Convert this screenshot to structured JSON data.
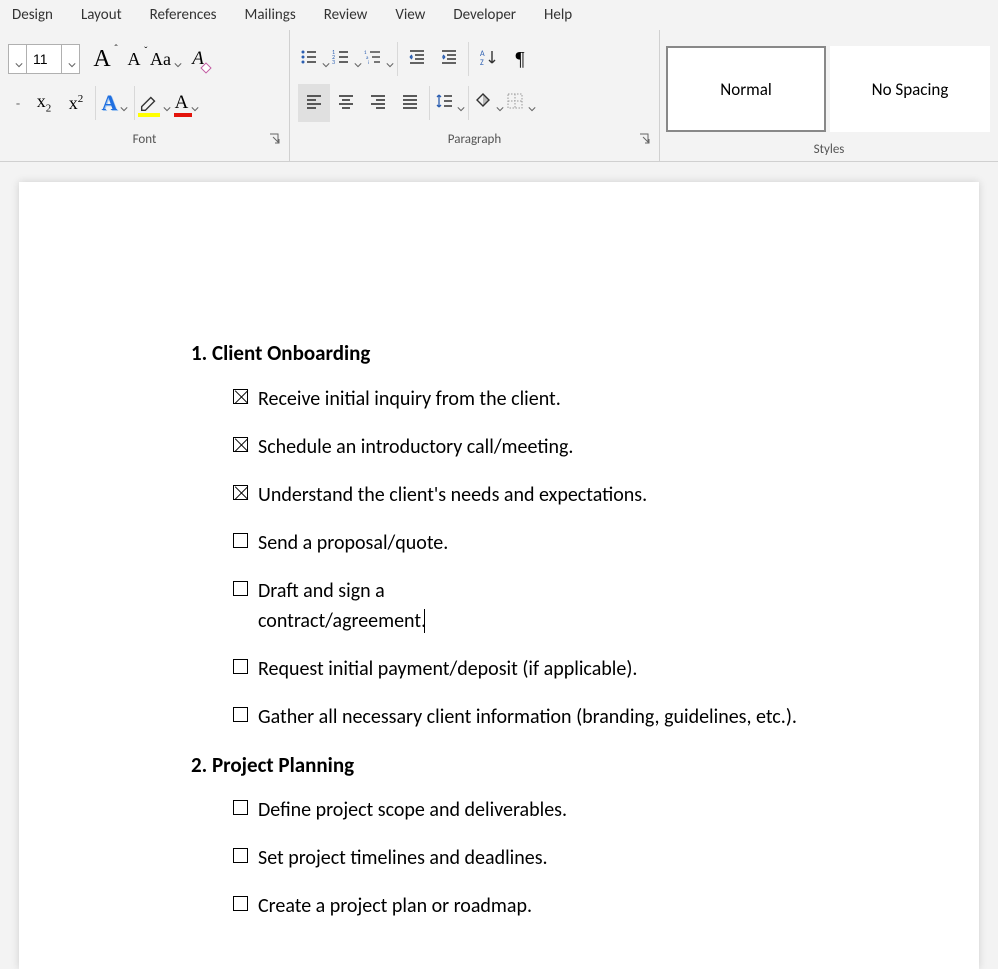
{
  "tabs": [
    "Design",
    "Layout",
    "References",
    "Mailings",
    "Review",
    "View",
    "Developer",
    "Help"
  ],
  "font": {
    "size": "11",
    "groupLabel": "Font"
  },
  "paragraph": {
    "groupLabel": "Paragraph"
  },
  "styles": {
    "groupLabel": "Styles",
    "normal": "Normal",
    "nospacing": "No Spacing"
  },
  "doc": {
    "sections": [
      {
        "title": "1. Client Onboarding",
        "items": [
          {
            "checked": true,
            "text": "Receive initial inquiry from the client."
          },
          {
            "checked": true,
            "text": "Schedule an introductory call/meeting."
          },
          {
            "checked": true,
            "text": "Understand the client's needs and expectations."
          },
          {
            "checked": false,
            "text": "Send a proposal/quote."
          },
          {
            "checked": false,
            "text": "Draft and sign a contract/agreement.",
            "cursor": true
          },
          {
            "checked": false,
            "text": "Request initial payment/deposit (if applicable)."
          },
          {
            "checked": false,
            "text": "Gather all necessary client information (branding, guidelines, etc.)."
          }
        ]
      },
      {
        "title": "2. Project Planning",
        "items": [
          {
            "checked": false,
            "text": "Define project scope and deliverables."
          },
          {
            "checked": false,
            "text": "Set project timelines and deadlines."
          },
          {
            "checked": false,
            "text": "Create a project plan or roadmap."
          }
        ]
      }
    ]
  }
}
